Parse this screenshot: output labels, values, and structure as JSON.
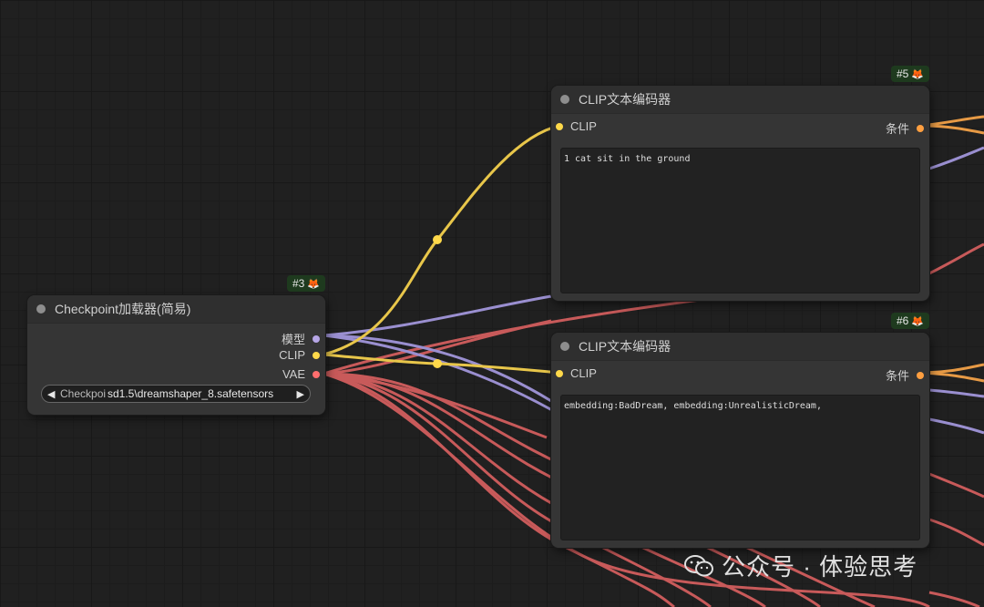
{
  "nodes": {
    "checkpoint": {
      "id": "#3",
      "title": "Checkpoint加载器(简易)",
      "outputs": [
        "模型",
        "CLIP",
        "VAE"
      ],
      "widget": {
        "label": "Checkpoi",
        "value": "sd1.5\\dreamshaper_8.safetensors"
      }
    },
    "clip_positive": {
      "id": "#5",
      "title": "CLIP文本编码器",
      "input": "CLIP",
      "output": "条件",
      "text": "1 cat sit in the ground"
    },
    "clip_negative": {
      "id": "#6",
      "title": "CLIP文本编码器",
      "input": "CLIP",
      "output": "条件",
      "text": "embedding:BadDream, embedding:UnrealisticDream,"
    }
  },
  "colors": {
    "clip": "#ffd94a",
    "model": "#b6a6e6",
    "vae": "#ff6e6e",
    "conditioning": "#ff9f40"
  },
  "watermark": {
    "text": "公众号 · 体验思考",
    "icon": "wechat-icon"
  }
}
